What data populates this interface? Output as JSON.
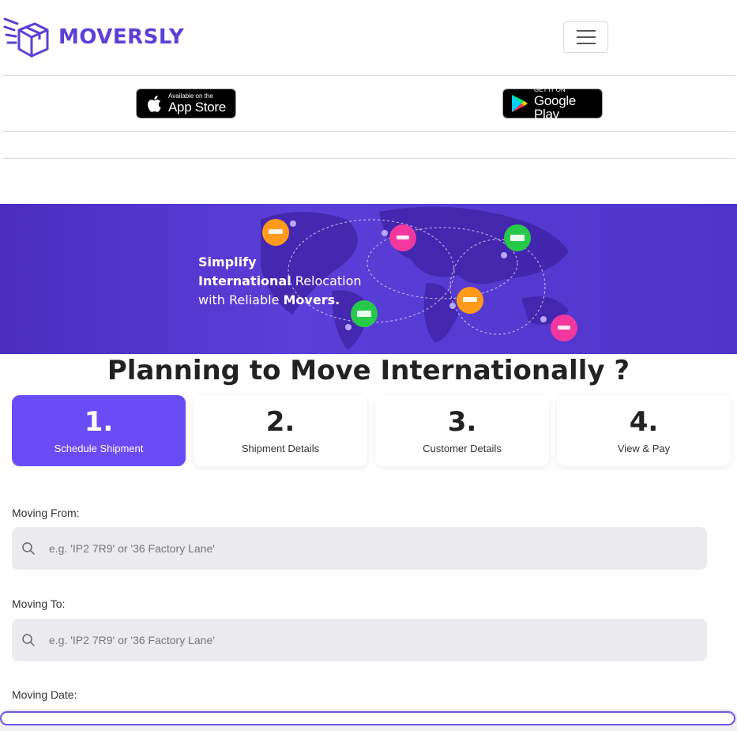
{
  "brand": {
    "name": "MOVERSLY",
    "color": "#5b3fd6"
  },
  "header": {
    "menu_icon": "hamburger-icon"
  },
  "stores": {
    "apple": {
      "small": "Available on the",
      "big": "App Store",
      "icon": "apple-icon"
    },
    "google": {
      "small": "GET IT ON",
      "big": "Google Play",
      "icon": "play-icon"
    }
  },
  "banner": {
    "line1": "Simplify",
    "line2_bold": "International",
    "line2_rest": " Relocation",
    "line3_rest": "with Reliable ",
    "line3_bold": "Movers."
  },
  "headline": "Planning to Move Internationally ?",
  "steps": [
    {
      "num": "1.",
      "label": "Schedule Shipment",
      "active": true
    },
    {
      "num": "2.",
      "label": "Shipment Details",
      "active": false
    },
    {
      "num": "3.",
      "label": "Customer Details",
      "active": false
    },
    {
      "num": "4.",
      "label": "View & Pay",
      "active": false
    }
  ],
  "form": {
    "from": {
      "label": "Moving From:",
      "placeholder": "e.g. 'IP2 7R9' or '36 Factory Lane'"
    },
    "to": {
      "label": "Moving To:",
      "placeholder": "e.g. 'IP2 7R9' or '36 Factory Lane'"
    },
    "date": {
      "label": "Moving Date:"
    }
  },
  "colors": {
    "accent": "#6a4cf5",
    "banner": "#4f34c9",
    "field_bg": "#ebebef"
  }
}
